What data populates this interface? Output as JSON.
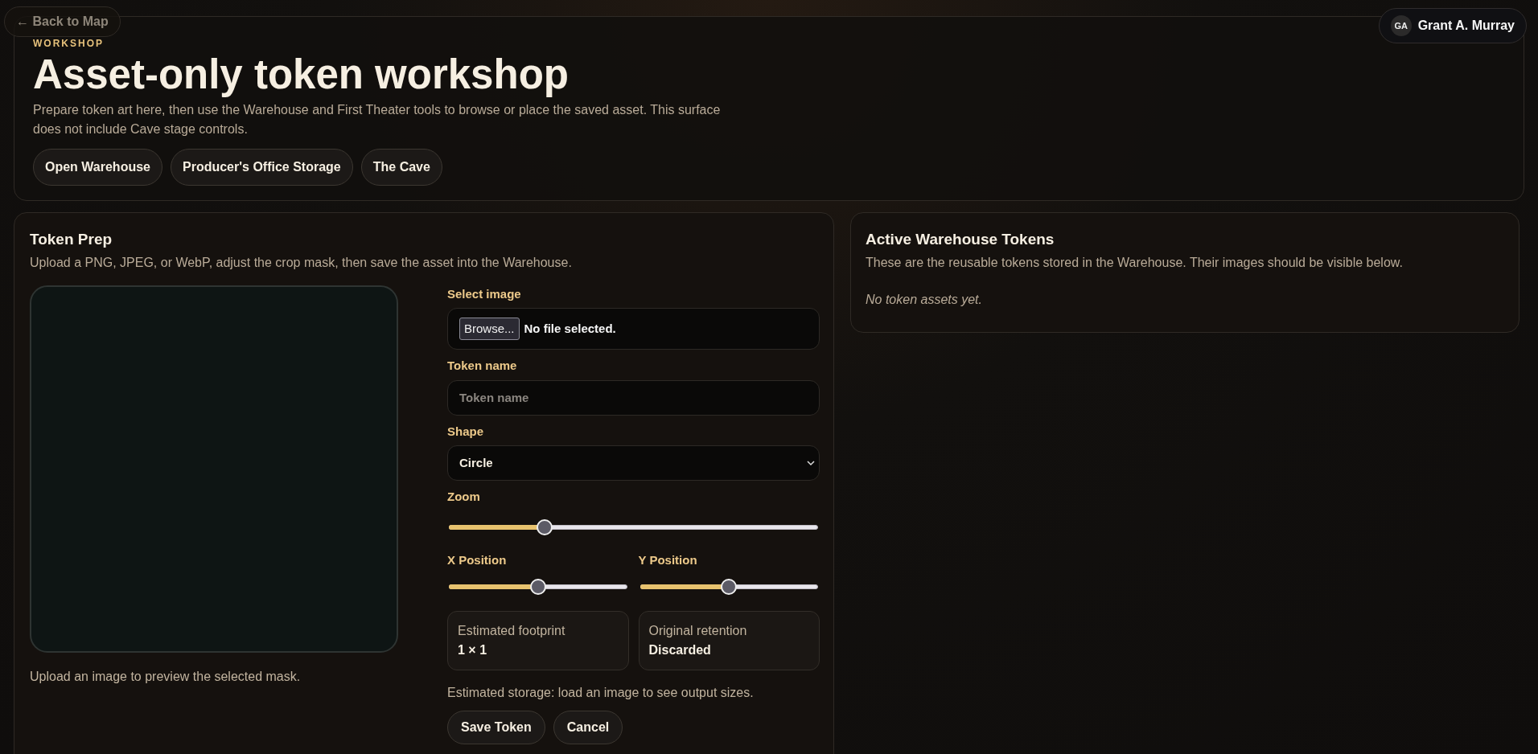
{
  "back_link": "← Back to Map",
  "user": {
    "initials": "GA",
    "name": "Grant A. Murray"
  },
  "header": {
    "eyebrow": "WORKSHOP",
    "title": "Asset-only token workshop",
    "description": "Prepare token art here, then use the Warehouse and First Theater tools to browse or place the saved asset. This surface does not include Cave stage controls.",
    "buttons": [
      "Open Warehouse",
      "Producer's Office Storage",
      "The Cave"
    ]
  },
  "token_prep": {
    "title": "Token Prep",
    "subtitle": "Upload a PNG, JPEG, or WebP, adjust the crop mask, then save the asset into the Warehouse.",
    "preview_caption": "Upload an image to preview the selected mask.",
    "select_image": {
      "label": "Select image",
      "button": "Browse...",
      "status": "No file selected."
    },
    "token_name": {
      "label": "Token name",
      "placeholder": "Token name"
    },
    "shape": {
      "label": "Shape",
      "value": "Circle"
    },
    "zoom": {
      "label": "Zoom",
      "level": 0.26
    },
    "x_position": {
      "label": "X Position",
      "level": 0.5
    },
    "y_position": {
      "label": "Y Position",
      "level": 0.5
    },
    "info": [
      {
        "label": "Estimated footprint",
        "value": "1 × 1"
      },
      {
        "label": "Original retention",
        "value": "Discarded"
      }
    ],
    "storage_note": "Estimated storage: load an image to see output sizes.",
    "actions": [
      "Save Token",
      "Cancel"
    ]
  },
  "active_tokens": {
    "title": "Active Warehouse Tokens",
    "subtitle": "These are the reusable tokens stored in the Warehouse. Their images should be visible below.",
    "empty": "No token assets yet."
  }
}
